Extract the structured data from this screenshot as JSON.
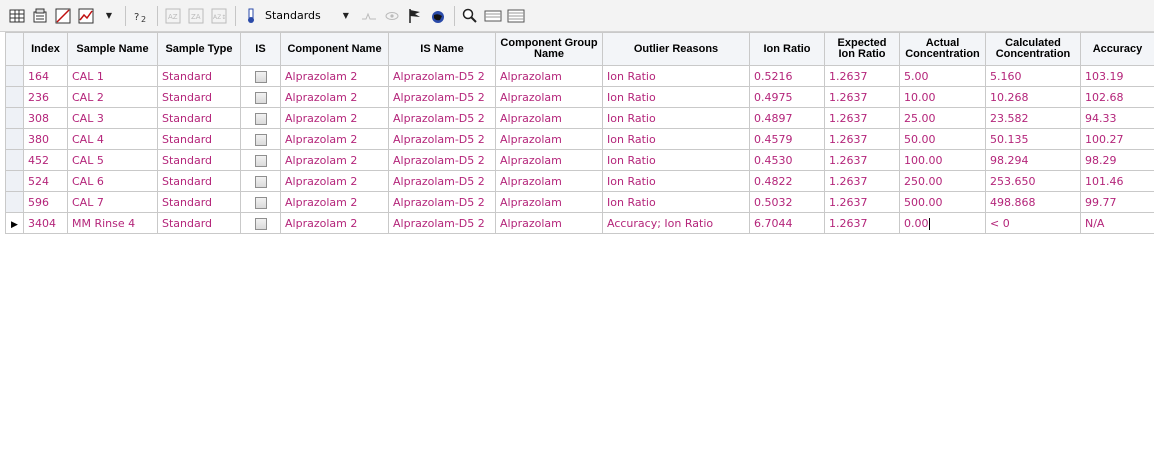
{
  "toolbar": {
    "standards_label": "Standards",
    "icons": [
      "table-icon",
      "calculator-icon",
      "calibration-curve-icon",
      "line-chart-icon",
      "chart-dropdown-icon",
      "formula-icon",
      "az-sort-icon",
      "za-sort-icon",
      "sort-options-icon",
      "flask-icon",
      "standards-dropdown-icon",
      "peak-icon",
      "eye-icon",
      "flag-icon",
      "globe-icon",
      "zoom-icon",
      "grid-view-icon",
      "list-view-icon"
    ]
  },
  "table": {
    "headers": [
      "Index",
      "Sample Name",
      "Sample Type",
      "IS",
      "Component Name",
      "IS Name",
      "Component Group Name",
      "Outlier Reasons",
      "Ion Ratio",
      "Expected Ion Ratio",
      "Actual Concentration",
      "Calculated Concentration",
      "Accuracy"
    ],
    "rows": [
      {
        "index": "164",
        "sample_name": "CAL 1",
        "sample_type": "Standard",
        "component": "Alprazolam 2",
        "is_name": "Alprazolam-D5 2",
        "group": "Alprazolam",
        "outlier": "Ion Ratio",
        "ion_ratio": "0.5216",
        "expected": "1.2637",
        "actual": "5.00",
        "calculated": "5.160",
        "accuracy": "103.19"
      },
      {
        "index": "236",
        "sample_name": "CAL 2",
        "sample_type": "Standard",
        "component": "Alprazolam 2",
        "is_name": "Alprazolam-D5 2",
        "group": "Alprazolam",
        "outlier": "Ion Ratio",
        "ion_ratio": "0.4975",
        "expected": "1.2637",
        "actual": "10.00",
        "calculated": "10.268",
        "accuracy": "102.68"
      },
      {
        "index": "308",
        "sample_name": "CAL 3",
        "sample_type": "Standard",
        "component": "Alprazolam 2",
        "is_name": "Alprazolam-D5 2",
        "group": "Alprazolam",
        "outlier": "Ion Ratio",
        "ion_ratio": "0.4897",
        "expected": "1.2637",
        "actual": "25.00",
        "calculated": "23.582",
        "accuracy": "94.33"
      },
      {
        "index": "380",
        "sample_name": "CAL 4",
        "sample_type": "Standard",
        "component": "Alprazolam 2",
        "is_name": "Alprazolam-D5 2",
        "group": "Alprazolam",
        "outlier": "Ion Ratio",
        "ion_ratio": "0.4579",
        "expected": "1.2637",
        "actual": "50.00",
        "calculated": "50.135",
        "accuracy": "100.27"
      },
      {
        "index": "452",
        "sample_name": "CAL 5",
        "sample_type": "Standard",
        "component": "Alprazolam 2",
        "is_name": "Alprazolam-D5 2",
        "group": "Alprazolam",
        "outlier": "Ion Ratio",
        "ion_ratio": "0.4530",
        "expected": "1.2637",
        "actual": "100.00",
        "calculated": "98.294",
        "accuracy": "98.29"
      },
      {
        "index": "524",
        "sample_name": "CAL 6",
        "sample_type": "Standard",
        "component": "Alprazolam 2",
        "is_name": "Alprazolam-D5 2",
        "group": "Alprazolam",
        "outlier": "Ion Ratio",
        "ion_ratio": "0.4822",
        "expected": "1.2637",
        "actual": "250.00",
        "calculated": "253.650",
        "accuracy": "101.46"
      },
      {
        "index": "596",
        "sample_name": "CAL 7",
        "sample_type": "Standard",
        "component": "Alprazolam 2",
        "is_name": "Alprazolam-D5 2",
        "group": "Alprazolam",
        "outlier": "Ion Ratio",
        "ion_ratio": "0.5032",
        "expected": "1.2637",
        "actual": "500.00",
        "calculated": "498.868",
        "accuracy": "99.77"
      },
      {
        "index": "3404",
        "sample_name": "MM Rinse 4",
        "sample_type": "Standard",
        "component": "Alprazolam 2",
        "is_name": "Alprazolam-D5 2",
        "group": "Alprazolam",
        "outlier": "Accuracy; Ion Ratio",
        "ion_ratio": "6.7044",
        "expected": "1.2637",
        "actual": "0.00",
        "calculated": "< 0",
        "accuracy": "N/A",
        "current": true
      }
    ]
  },
  "colors": {
    "cell_text": "#b4257a",
    "header_bg": "#f3f5f8",
    "grid_line": "#c9c9c9"
  }
}
